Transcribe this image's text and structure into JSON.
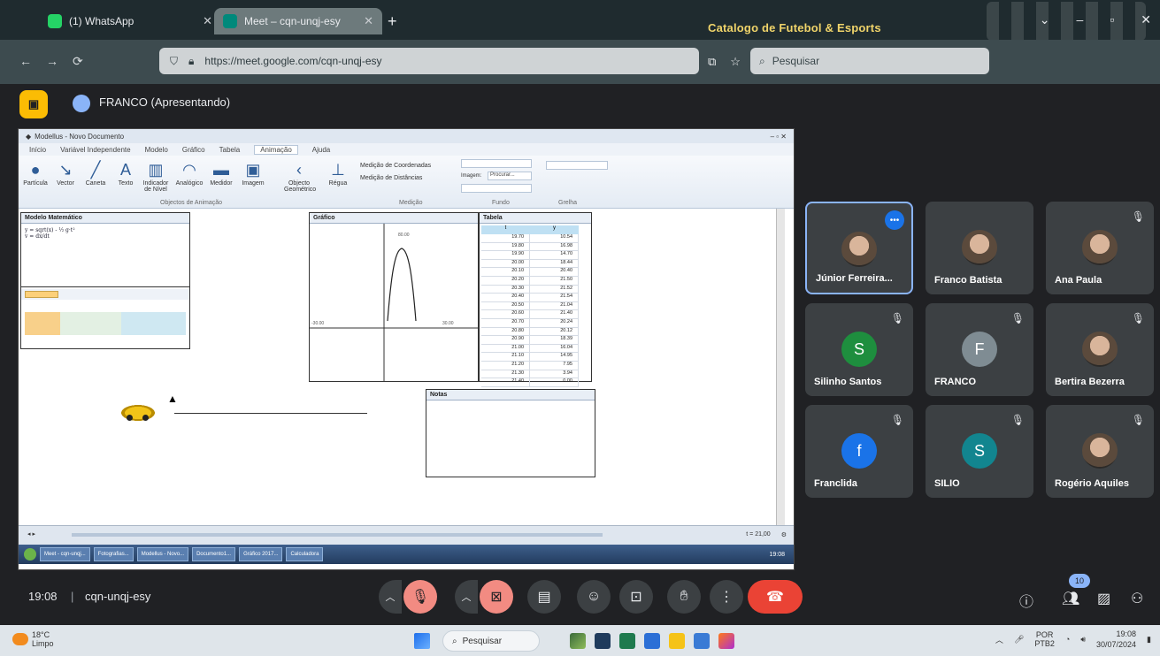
{
  "browser": {
    "tabs": [
      {
        "label": "(1) WhatsApp",
        "color": "#25d366"
      },
      {
        "label": "Meet – cqn-unqj-esy",
        "color": "#00897b"
      }
    ],
    "window_title": "Catalogo de Futebol & Esports",
    "url": "https://meet.google.com/cqn-unqj-esy",
    "search_placeholder": "Pesquisar"
  },
  "meet": {
    "presenter_label": "FRANCO (Apresentando)",
    "participants": [
      {
        "name": "Júnior Ferreira...",
        "initial": "",
        "avatar_color": "#5f6368",
        "muted": false,
        "photo": true
      },
      {
        "name": "Franco Batista",
        "initial": "",
        "avatar_color": "#5f6368",
        "muted": false,
        "photo": true
      },
      {
        "name": "Ana Paula",
        "initial": "",
        "avatar_color": "#5f6368",
        "muted": true,
        "photo": true
      },
      {
        "name": "Silinho Santos",
        "initial": "S",
        "avatar_color": "#1e8e3e",
        "muted": true,
        "photo": false
      },
      {
        "name": "FRANCO",
        "initial": "F",
        "avatar_color": "#7f8c93",
        "muted": true,
        "photo": false
      },
      {
        "name": "Bertira Bezerra",
        "initial": "",
        "avatar_color": "#5f6368",
        "muted": true,
        "photo": true
      },
      {
        "name": "Franclida",
        "initial": "f",
        "avatar_color": "#1a73e8",
        "muted": true,
        "photo": false
      },
      {
        "name": "SILIO",
        "initial": "S",
        "avatar_color": "#12858f",
        "muted": true,
        "photo": false
      },
      {
        "name": "Rogério Aquiles",
        "initial": "",
        "avatar_color": "#5f6368",
        "muted": true,
        "photo": true
      }
    ],
    "meeting_time": "19:08",
    "meeting_separator": "|",
    "meeting_code": "cqn-unqj-esy",
    "people_count": "10"
  },
  "shared": {
    "app_title": "Modellus - Novo Documento",
    "ribbon_tabs": [
      "Início",
      "Variável Independente",
      "Modelo",
      "Gráfico",
      "Tabela",
      "Animação",
      "Ajuda"
    ],
    "active_tab": "Animação",
    "tools": [
      "Partícula",
      "Vector",
      "Caneta",
      "Texto",
      "Indicador de Nível",
      "Analógico",
      "Medidor",
      "Imagem",
      "Objecto Geométrico",
      "Régua"
    ],
    "ribbon_groups": [
      "Objectos de Animação",
      "Medição",
      "Fundo",
      "Grelha"
    ],
    "measure_options": [
      "Medição de Coordenadas",
      "Medição de Distâncias"
    ],
    "image_label": "Imagem:",
    "image_button": "Procurar...",
    "panels": {
      "modelo": "Modelo Matemático",
      "grafico": "Gráfico",
      "tabela": "Tabela",
      "notas": "Notas"
    },
    "model_lines": [
      "y = sqrt(x) - ½ g·t²",
      "v = dx/dt"
    ],
    "table_rows": [
      [
        "19.70",
        "10.54"
      ],
      [
        "19.80",
        "16.98"
      ],
      [
        "19.90",
        "14.70"
      ],
      [
        "20.00",
        "18.44"
      ],
      [
        "20.10",
        "20.40"
      ],
      [
        "20.20",
        "21.50"
      ],
      [
        "20.30",
        "21.52"
      ],
      [
        "20.40",
        "21.54"
      ],
      [
        "20.50",
        "21.04"
      ],
      [
        "20.60",
        "21.40"
      ],
      [
        "20.70",
        "20.24"
      ],
      [
        "20.80",
        "20.12"
      ],
      [
        "20.90",
        "18.39"
      ],
      [
        "21.00",
        "16.04"
      ],
      [
        "21.10",
        "14.95"
      ],
      [
        "21.20",
        "7.95"
      ],
      [
        "21.30",
        "3.94"
      ],
      [
        "21.40",
        "0.00"
      ]
    ],
    "status_text": "t = 21,00",
    "taskbar_items": [
      "Meet - cqn-unqj...",
      "Fotografias...",
      "Modellus - Novo...",
      "Documento1...",
      "Gráfico 2017...",
      "Calculadora"
    ],
    "taskbar_clock": "19:08"
  },
  "controls": {
    "mic_icon": "mic-off-icon",
    "cam_icon": "cam-off-icon",
    "captions_icon": "captions-icon",
    "emoji_icon": "emoji-icon",
    "present_icon": "present-icon",
    "hand_icon": "raise-hand-icon",
    "more_icon": "more-icon",
    "hangup_icon": "hangup-icon"
  },
  "os_taskbar": {
    "weather_temp": "18°C",
    "weather_desc": "Limpo",
    "search_label": "Pesquisar",
    "lang_top": "POR",
    "lang_bottom": "PTB2",
    "time": "19:08",
    "date": "30/07/2024"
  }
}
